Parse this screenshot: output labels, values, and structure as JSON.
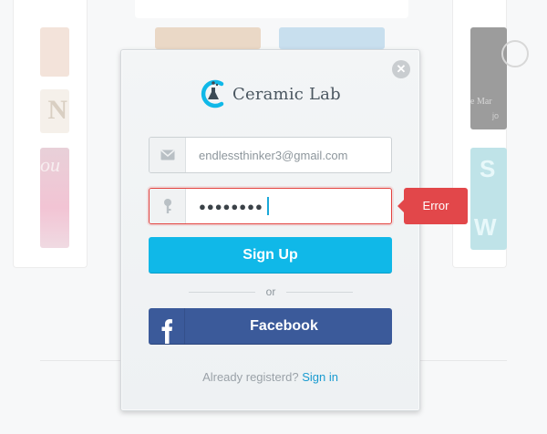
{
  "brand": {
    "name": "Ceramic Lab",
    "accent_color": "#10b8e8"
  },
  "background": {
    "left_tile_text_1": "N",
    "left_tile_text_2": "ou",
    "right_tile_text_1": "e Mar",
    "right_tile_text_2": "jo"
  },
  "modal": {
    "close_icon": "close-icon"
  },
  "form": {
    "email": {
      "icon": "envelope-icon",
      "value": "endlessthinker3@gmail.com"
    },
    "password": {
      "icon": "key-icon",
      "masked_value": "●●●●●●●●",
      "error_label": "Error",
      "error_color": "#e2474a"
    },
    "signup_label": "Sign Up",
    "or_label": "or",
    "facebook_label": "Facebook",
    "facebook_color": "#3b5a9a"
  },
  "footer": {
    "question": "Already registerd?",
    "signin_label": "Sign in"
  }
}
